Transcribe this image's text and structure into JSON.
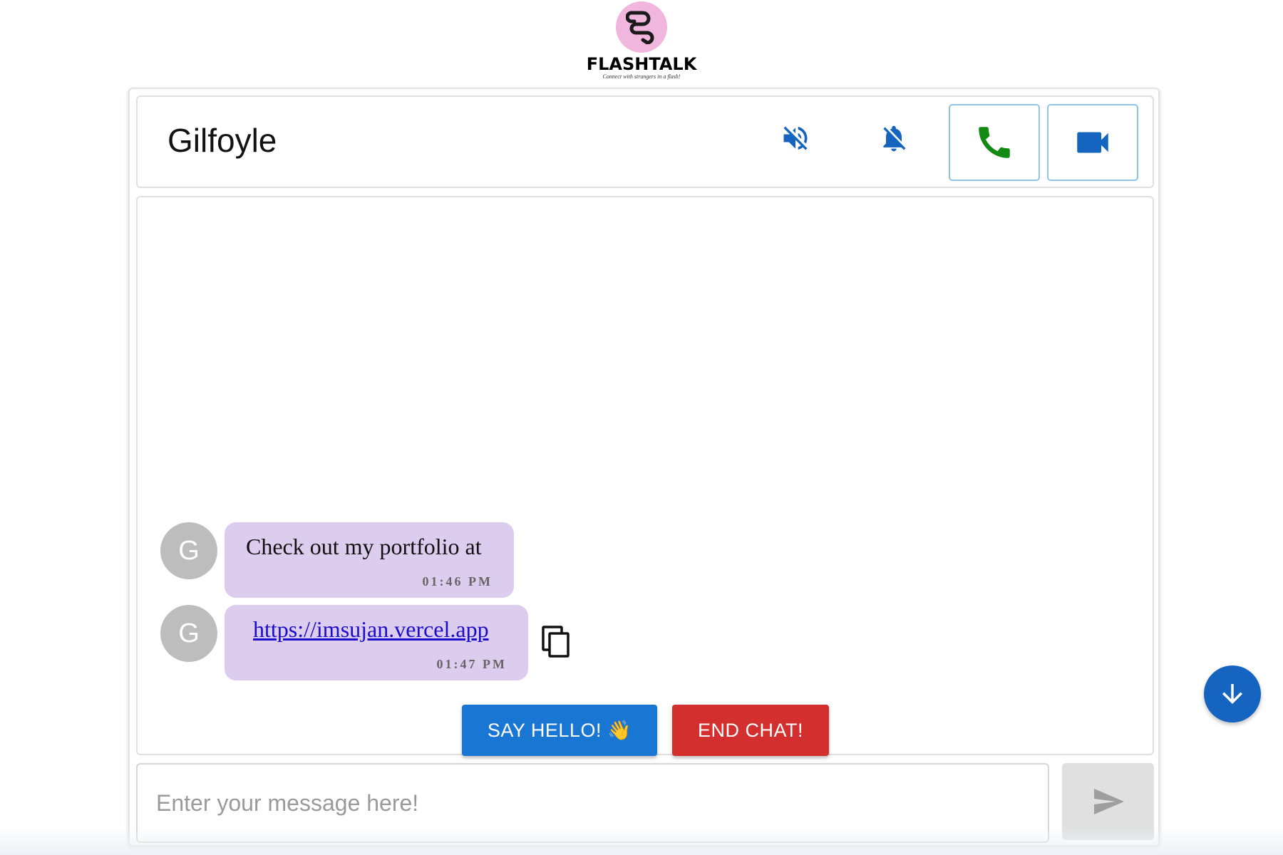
{
  "app": {
    "name": "FLASHTALK",
    "tagline": "Connect with strangers in a flash!"
  },
  "header": {
    "partner_name": "Gilfoyle",
    "icons": [
      "volume-off-icon",
      "notifications-off-icon",
      "phone-icon",
      "videocam-icon"
    ]
  },
  "messages": [
    {
      "avatar": "G",
      "text": "Check out my portfolio at",
      "time": "01:46 PM",
      "is_link": false
    },
    {
      "avatar": "G",
      "text": "https://imsujan.vercel.app",
      "time": "01:47 PM",
      "is_link": true
    }
  ],
  "actions": {
    "say_hello": "SAY HELLO!",
    "end_chat": "END CHAT!"
  },
  "composer": {
    "placeholder": "Enter your message here!"
  },
  "colors": {
    "logo_circle": "#f1b6de",
    "bubble": "#dccdef",
    "primary": "#1976d2",
    "danger": "#d32f2f",
    "call_green": "#138a13",
    "video_blue": "#1565c0",
    "avatar": "#bdbdbd"
  }
}
